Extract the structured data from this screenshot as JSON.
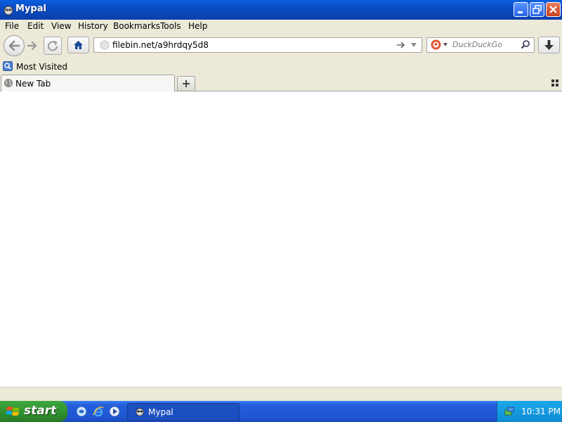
{
  "window": {
    "title": "Mypal"
  },
  "menu": [
    "File",
    "Edit",
    "View",
    "History",
    "Bookmarks",
    "Tools",
    "Help"
  ],
  "toolbar": {
    "url": "filebin.net/a9hrdqy5d8",
    "search_placeholder": "DuckDuckGo"
  },
  "bookmarks": {
    "most_visited": "Most Visited"
  },
  "tabs": [
    {
      "label": "New Tab"
    }
  ],
  "taskbar": {
    "start": "start",
    "task_label": "Mypal",
    "clock": "10:31 PM"
  },
  "icons": {
    "app": "raccoon-icon",
    "back": "back-arrow-icon",
    "forward": "forward-arrow-icon",
    "reload": "reload-icon",
    "home": "home-icon",
    "go": "go-arrow-icon",
    "search_engine": "duckduckgo-icon",
    "search": "magnifier-icon",
    "download": "download-arrow-icon",
    "new_tab": "plus-icon",
    "tab_list": "grid-icon"
  },
  "colors": {
    "titlebar": "#0a50c8",
    "taskbar": "#245edb",
    "start": "#2e8e2e",
    "tray": "#0e8bd4",
    "close": "#c8401a"
  }
}
